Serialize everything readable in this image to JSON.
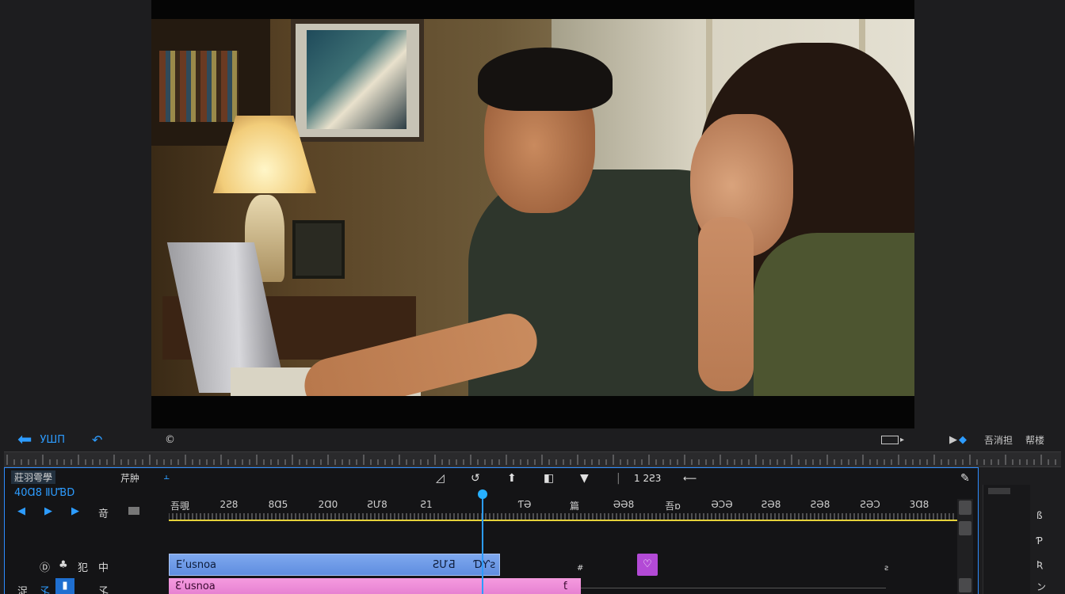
{
  "viewer": {
    "back_label": "УШП",
    "copyright_symbol": "©"
  },
  "viewer_bar": {
    "right_label_1": "吾消担",
    "right_label_2": "帮楼"
  },
  "timeline": {
    "panel_title": "莊羽雩學",
    "panel_label_2": "芹肿",
    "timecode": "40Ɑ8 ⅡƯƁD",
    "row_icons": [
      "◀",
      "▶",
      "▶",
      "竒"
    ],
    "track_v_icons": [
      "Ⓓ",
      "♣",
      "犯",
      "中"
    ],
    "track_a_icons": [
      "浞",
      "孓",
      "▮",
      "孓"
    ],
    "toolbar_value": "1 2Ƨ3",
    "toolbar_arrow": "⟵",
    "ruler_labels": [
      "吾覗",
      "2Ƨ8",
      "8Ɑ5",
      "2Ɑ0",
      "ƧƯ8",
      "Ƨ1",
      "",
      "ƬƏ",
      "篇",
      "ƏƏ8",
      "吾ɒ",
      "ƏƆƏ",
      "ƧƏ8",
      "ƧƏ8",
      "ƧƏƆ",
      "3Ɑ8"
    ],
    "clip_blue_label": "Eʹusnoa",
    "clip_blue_time_1": "ƧƯƋ",
    "clip_blue_time_2": "ƊƳƨ",
    "clip_pink_label": "Ɛʹusnoa",
    "clip_purple_icon": "♡",
    "pink_marker": "ƭ",
    "mid_marker_1": "#",
    "mid_marker_2": "ƨ"
  },
  "side_panel": {
    "items": [
      "ß",
      "Ƥ",
      "Ʀ",
      "ン"
    ]
  },
  "colors": {
    "accent": "#2d9cff",
    "clip_blue": "#6e9be6",
    "clip_pink": "#ef8fd9",
    "clip_purple": "#b34ad6",
    "ruler_yellow": "#e5d23a"
  }
}
